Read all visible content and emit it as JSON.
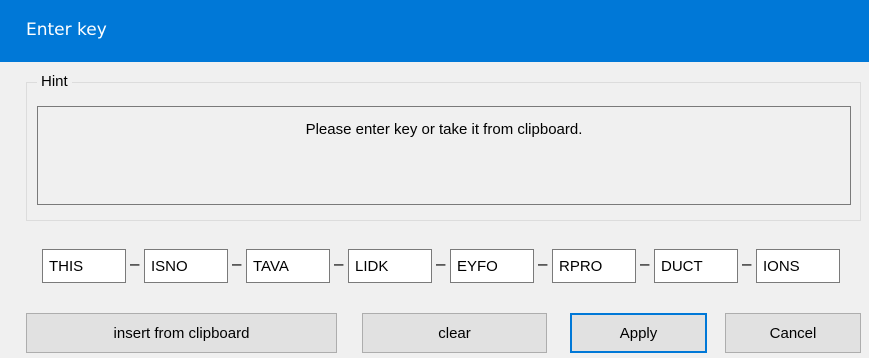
{
  "window": {
    "title": "Enter key",
    "title_color": "#0078d7"
  },
  "hint": {
    "group_label": "Hint",
    "text": "Please enter key or take it from clipboard."
  },
  "key": {
    "segments": [
      "THIS",
      "ISNO",
      "TAVA",
      "LIDK",
      "EYFO",
      "RPRO",
      "DUCT",
      "IONS"
    ],
    "separator": "–"
  },
  "buttons": {
    "insert_label": "insert from clipboard",
    "clear_label": "clear",
    "apply_label": "Apply",
    "cancel_label": "Cancel"
  }
}
